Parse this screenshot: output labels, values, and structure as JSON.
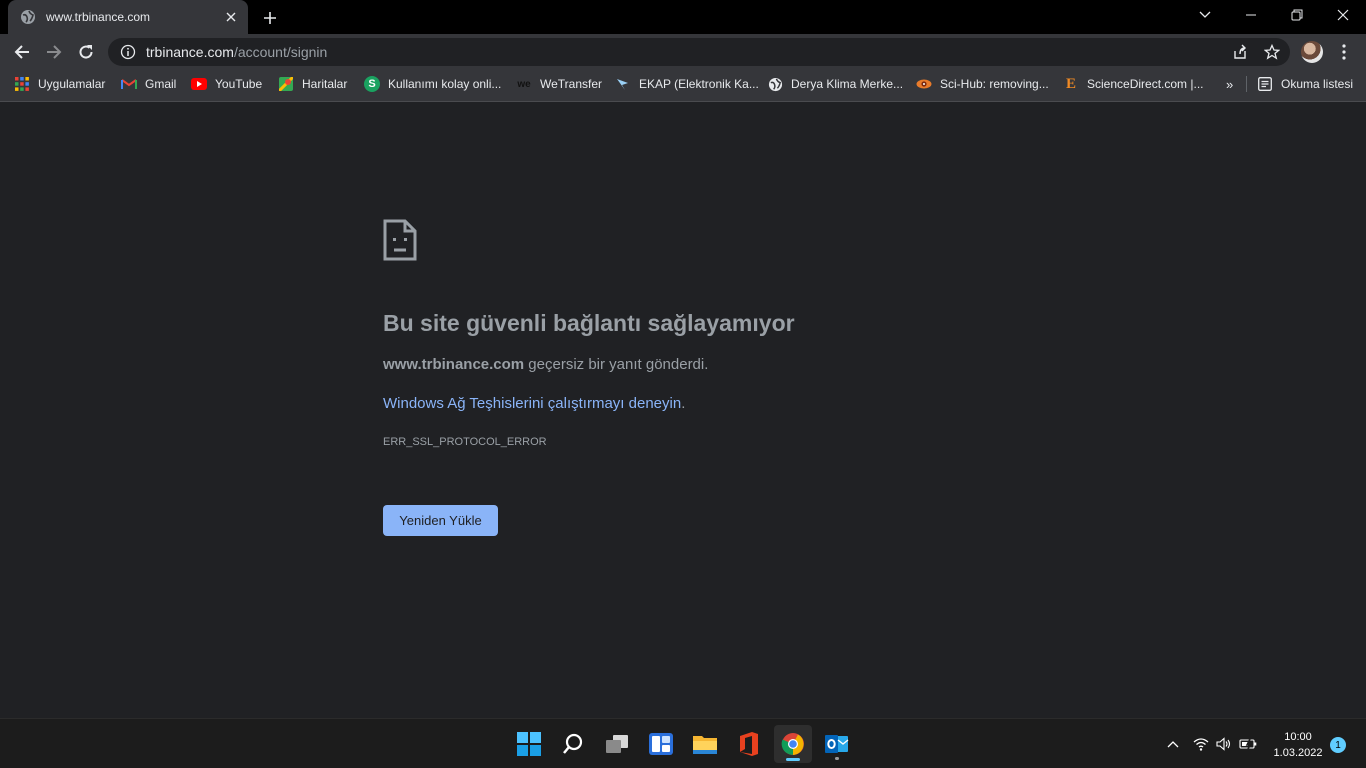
{
  "tab": {
    "title": "www.trbinance.com",
    "close_icon": "close-icon",
    "favicon": "globe-icon"
  },
  "new_tab_icon": "plus-icon",
  "window_controls": {
    "tab_search": "chevron-down-icon",
    "minimize": "minimize-icon",
    "restore": "restore-icon",
    "close": "close-icon"
  },
  "toolbar": {
    "back_icon": "arrow-left-icon",
    "forward_icon": "arrow-right-icon",
    "reload_icon": "reload-icon",
    "url_host": "trbinance.com",
    "url_path": "/account/signin",
    "share_icon": "share-icon",
    "bookmark_icon": "star-icon",
    "menu_icon": "kebab-menu-icon"
  },
  "bookmarks": [
    {
      "label": "Uygulamalar",
      "icon": "apps-grid-icon"
    },
    {
      "label": "Gmail",
      "icon": "gmail-icon"
    },
    {
      "label": "YouTube",
      "icon": "youtube-icon"
    },
    {
      "label": "Haritalar",
      "icon": "maps-icon"
    },
    {
      "label": "Kullanımı kolay onli...",
      "icon": "s-logo-icon"
    },
    {
      "label": "WeTransfer",
      "icon": "wetransfer-icon"
    },
    {
      "label": "EKAP (Elektronik Ka...",
      "icon": "ekap-icon"
    },
    {
      "label": "Derya Klima Merke...",
      "icon": "globe-icon"
    },
    {
      "label": "Sci-Hub: removing...",
      "icon": "scihub-icon"
    },
    {
      "label": "ScienceDirect.com |...",
      "icon": "elsevier-e-icon"
    }
  ],
  "bookmarks_overflow": "»",
  "reading_list": {
    "label": "Okuma listesi",
    "icon": "reading-list-icon"
  },
  "error": {
    "icon": "sad-page-icon",
    "title": "Bu site güvenli bağlantı sağlayamıyor",
    "host": "www.trbinance.com",
    "message": " geçersiz bir yanıt gönderdi.",
    "link": "Windows Ağ Teşhislerini çalıştırmayı deneyin",
    "link_suffix": ".",
    "code": "ERR_SSL_PROTOCOL_ERROR",
    "reload_label": "Yeniden Yükle"
  },
  "taskbar": {
    "apps": [
      "windows-start-icon",
      "search-icon",
      "task-view-icon",
      "widgets-icon",
      "file-explorer-icon",
      "office-icon",
      "chrome-icon",
      "outlook-icon"
    ],
    "tray": [
      "chevron-up-icon",
      "wifi-icon",
      "volume-icon",
      "battery-icon"
    ],
    "time": "10:00",
    "date": "1.03.2022",
    "notifications": "1"
  },
  "colors": {
    "accent": "#8ab4f8",
    "background": "#202124",
    "toolbar": "#35363a",
    "taskbar_accent": "#60cdff"
  }
}
